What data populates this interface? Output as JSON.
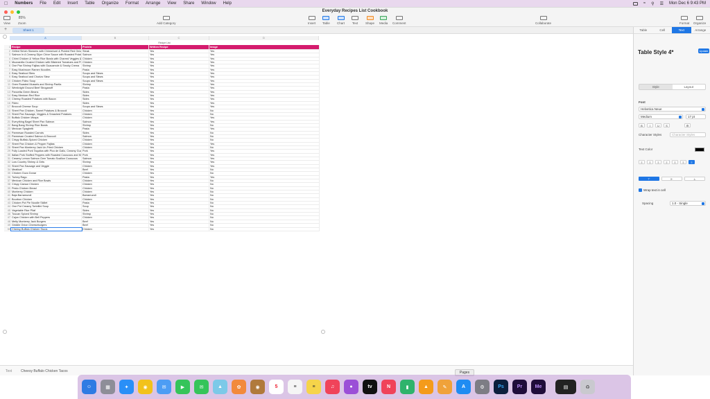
{
  "menubar": {
    "apple": "",
    "app_name": "Numbers",
    "items": [
      "File",
      "Edit",
      "Insert",
      "Table",
      "Organize",
      "Format",
      "Arrange",
      "View",
      "Share",
      "Window",
      "Help"
    ],
    "clock": "Mon Dec 6  9:43 PM"
  },
  "window": {
    "title": "Everyday Recipes List Cookbook",
    "toolbar": {
      "view": "View",
      "zoom_value": "85%",
      "zoom": "Zoom",
      "add_category": "Add Category",
      "insert": "Insert",
      "table": "Table",
      "chart": "Chart",
      "text": "Text",
      "shape": "Shape",
      "media": "Media",
      "comment": "Comment",
      "collaborate": "Collaborate",
      "format": "Format",
      "organize": "Organize"
    },
    "sheet_tab": "Sheet 1"
  },
  "sheet": {
    "col_headers": [
      "A",
      "B",
      "C",
      "D"
    ],
    "table_title": "Recipe List",
    "headers": [
      "Recipe",
      "Protein",
      "Written Recipe",
      "Image"
    ],
    "rows": [
      [
        "Grilled Sirloin Skewers with Chimichurri & Pickled Red Onion",
        "Steak",
        "Yes",
        "Yes"
      ],
      [
        "Salmon In A Creamy Dijon Chive Sauce with Roasted Potato Wedges & Lemony Zucchini",
        "Salmon",
        "Yes",
        "Yes"
      ],
      [
        "Chimi Chicken & Yellow Rice Bowls with Charred Veggies & Fresh Salsa",
        "Chicken",
        "Yes",
        "Yes"
      ],
      [
        "Mozzarella Crusted Chicken with Blistered Tomatoes and Potato Wedges",
        "Chicken",
        "Yes",
        "Yes"
      ],
      [
        "One Pan Shrimp Fajitas with Guacamole & Smoky Crema",
        "Shrimp",
        "Yes",
        "Yes"
      ],
      [
        "Easy Mushroom Ramen Noodles",
        "Pasta",
        "Yes",
        "Yes"
      ],
      [
        "Easy Seafood Stew",
        "Soups and Stews",
        "Yes",
        "Yes"
      ],
      [
        "Easy Seafood and Chorizo Stew",
        "Soups and Stews",
        "Yes",
        "Yes"
      ],
      [
        "Chicken Fideo Soup",
        "Soups and Stews",
        "Yes",
        "Yes"
      ],
      [
        "Oven Roasted Mussels and Shrimp Paella",
        "Shrimp",
        "Yes",
        "Yes"
      ],
      [
        "Weeknight Ground Beef Stroganoff",
        "Pasta",
        "Yes",
        "Yes"
      ],
      [
        "Pancetta Green Beans",
        "Sides",
        "Yes",
        "Yes"
      ],
      [
        "Easy Mexican Red Rice",
        "Sides",
        "Yes",
        "Yes"
      ],
      [
        "Cheesy Roasted Potatoes with Bacon",
        "Sides",
        "Yes",
        "Yes"
      ],
      [
        "Fideo",
        "Sides",
        "Yes",
        "Yes"
      ],
      [
        "Broccoli Cheese Soup",
        "Soups and Stews",
        "Yes",
        "Yes"
      ],
      [
        "Sheet Pan Chicken, Sweet Potatoes & Broccoli",
        "Chicken",
        "Yes",
        "No"
      ],
      [
        "Sheet Pan Sausage, Veggies & Smashed Potatoes",
        "Chicken",
        "Yes",
        "No"
      ],
      [
        "Buffalo Chicken Wraps",
        "Chicken",
        "Yes",
        "Yes"
      ],
      [
        "Everything Bagel Sheet Pan Salmon",
        "Salmon",
        "Yes",
        "Yes"
      ],
      [
        "Bang Bang Shrimp Rice Bowls",
        "Shrimp",
        "Yes",
        "No"
      ],
      [
        "Mexican Spaghetti",
        "Pasta",
        "Yes",
        "Yes"
      ],
      [
        "Parmesan Roasted Carrots",
        "Sides",
        "Yes",
        "No"
      ],
      [
        "Parmesan Crusted Salmon & Broccoli",
        "Salmon",
        "Yes",
        "No"
      ],
      [
        "Crispy Buffalo-Spiced Chicken",
        "Chicken",
        "Yes",
        "No"
      ],
      [
        "Sheet Pan Chicken & Pepper Fajitas",
        "Chicken",
        "Yes",
        "Yes"
      ],
      [
        "Sheet Pan Monterey Jack Un-Fried Chicken",
        "Chicken",
        "Yes",
        "No"
      ],
      [
        "Fully Loaded Pork Taquitos with Pico de Gallo, Creamy Guacamole & Hot Sauce",
        "Pork",
        "Yes",
        "Yes"
      ],
      [
        "Italian Pork Stuffed Peppers with Roasted Couscous and Melted Mozzarella",
        "Pork",
        "Yes",
        "Yes"
      ],
      [
        "Creamy Lemon Salmon Over Tomato Scallion Couscous",
        "Salmon",
        "Yes",
        "Yes"
      ],
      [
        "Low Country Shrimp & Grits",
        "Shrimp",
        "Yes",
        "Yes"
      ],
      [
        "Sheet Pan Sausage and Veggie",
        "Chicken",
        "Yes",
        "Yes"
      ],
      [
        "Meatloaf",
        "Beef",
        "Yes",
        "No"
      ],
      [
        "Chicken Gozo Donar",
        "Chicken",
        "Yes",
        "No"
      ],
      [
        "Turkey Ragu",
        "Pasta",
        "Yes",
        "Yes"
      ],
      [
        "Mexican Chicken and Rice Bowls",
        "Chicken",
        "Yes",
        "No"
      ],
      [
        "Crispy Caesar Chicken",
        "Chicken",
        "Yes",
        "No"
      ],
      [
        "Pesto Chicken Bread",
        "Chicken",
        "Yes",
        "No"
      ],
      [
        "Monterey Chicken",
        "Chicken",
        "Yes",
        "No"
      ],
      [
        "Baja Barramundi",
        "Barramundi",
        "Yes",
        "No"
      ],
      [
        "Bourbon Chicken",
        "Chicken",
        "Yes",
        "No"
      ],
      [
        "Chicken Pot Pie Noodle Skillet",
        "Pasta",
        "Yes",
        "No"
      ],
      [
        "One Pot Creamy Tortellini Soup",
        "Soup",
        "Yes",
        "No"
      ],
      [
        "Vegetable Rice Pilaf",
        "Sides",
        "Yes",
        "No"
      ],
      [
        "Tuscan Spiced Shrimp",
        "Shrimp",
        "Yes",
        "No"
      ],
      [
        "Cajun Chicken with Bell Peppers",
        "Chicken",
        "Yes",
        "No"
      ],
      [
        "Melty Monterey Jack Burgers",
        "Beef",
        "Yes",
        "No"
      ],
      [
        "Griddle Onion Cheeseburgers",
        "Beef",
        "Yes",
        "No"
      ],
      [
        "Cheesy Buffalo Chicken Tacos",
        "Chicken",
        "Yes",
        "No"
      ]
    ]
  },
  "statusbar": {
    "label": "Text",
    "value": "Cheesy Buffalo Chicken Tacos",
    "pages": "Pages"
  },
  "inspector": {
    "tabs": [
      "Table",
      "Cell",
      "Text",
      "Arrange"
    ],
    "style_name": "Table Style 4*",
    "update": "Update",
    "seg_style": "Style",
    "seg_layout": "Layout",
    "font_label": "Font",
    "font_family": "Helvetica Neue",
    "font_weight": "Medium",
    "font_size": "17 pt",
    "char_styles_label": "Character Styles",
    "char_styles_value": "Character Styles",
    "text_color_label": "Text Color",
    "wrap_label": "Wrap text in cell",
    "spacing_label": "Spacing",
    "spacing_value": "1.0 - Single"
  }
}
